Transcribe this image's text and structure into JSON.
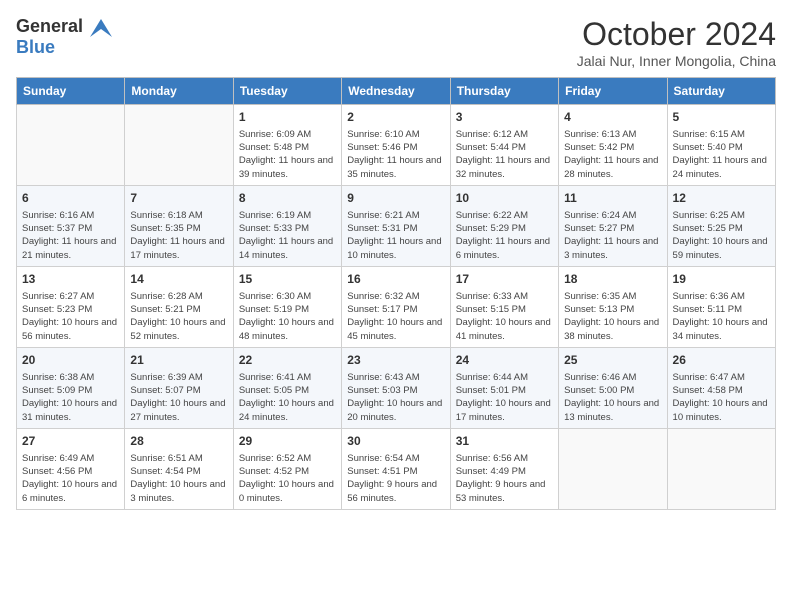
{
  "header": {
    "logo_general": "General",
    "logo_blue": "Blue",
    "month_title": "October 2024",
    "location": "Jalai Nur, Inner Mongolia, China"
  },
  "weekdays": [
    "Sunday",
    "Monday",
    "Tuesday",
    "Wednesday",
    "Thursday",
    "Friday",
    "Saturday"
  ],
  "weeks": [
    [
      {
        "day": "",
        "detail": ""
      },
      {
        "day": "",
        "detail": ""
      },
      {
        "day": "1",
        "detail": "Sunrise: 6:09 AM\nSunset: 5:48 PM\nDaylight: 11 hours and 39 minutes."
      },
      {
        "day": "2",
        "detail": "Sunrise: 6:10 AM\nSunset: 5:46 PM\nDaylight: 11 hours and 35 minutes."
      },
      {
        "day": "3",
        "detail": "Sunrise: 6:12 AM\nSunset: 5:44 PM\nDaylight: 11 hours and 32 minutes."
      },
      {
        "day": "4",
        "detail": "Sunrise: 6:13 AM\nSunset: 5:42 PM\nDaylight: 11 hours and 28 minutes."
      },
      {
        "day": "5",
        "detail": "Sunrise: 6:15 AM\nSunset: 5:40 PM\nDaylight: 11 hours and 24 minutes."
      }
    ],
    [
      {
        "day": "6",
        "detail": "Sunrise: 6:16 AM\nSunset: 5:37 PM\nDaylight: 11 hours and 21 minutes."
      },
      {
        "day": "7",
        "detail": "Sunrise: 6:18 AM\nSunset: 5:35 PM\nDaylight: 11 hours and 17 minutes."
      },
      {
        "day": "8",
        "detail": "Sunrise: 6:19 AM\nSunset: 5:33 PM\nDaylight: 11 hours and 14 minutes."
      },
      {
        "day": "9",
        "detail": "Sunrise: 6:21 AM\nSunset: 5:31 PM\nDaylight: 11 hours and 10 minutes."
      },
      {
        "day": "10",
        "detail": "Sunrise: 6:22 AM\nSunset: 5:29 PM\nDaylight: 11 hours and 6 minutes."
      },
      {
        "day": "11",
        "detail": "Sunrise: 6:24 AM\nSunset: 5:27 PM\nDaylight: 11 hours and 3 minutes."
      },
      {
        "day": "12",
        "detail": "Sunrise: 6:25 AM\nSunset: 5:25 PM\nDaylight: 10 hours and 59 minutes."
      }
    ],
    [
      {
        "day": "13",
        "detail": "Sunrise: 6:27 AM\nSunset: 5:23 PM\nDaylight: 10 hours and 56 minutes."
      },
      {
        "day": "14",
        "detail": "Sunrise: 6:28 AM\nSunset: 5:21 PM\nDaylight: 10 hours and 52 minutes."
      },
      {
        "day": "15",
        "detail": "Sunrise: 6:30 AM\nSunset: 5:19 PM\nDaylight: 10 hours and 48 minutes."
      },
      {
        "day": "16",
        "detail": "Sunrise: 6:32 AM\nSunset: 5:17 PM\nDaylight: 10 hours and 45 minutes."
      },
      {
        "day": "17",
        "detail": "Sunrise: 6:33 AM\nSunset: 5:15 PM\nDaylight: 10 hours and 41 minutes."
      },
      {
        "day": "18",
        "detail": "Sunrise: 6:35 AM\nSunset: 5:13 PM\nDaylight: 10 hours and 38 minutes."
      },
      {
        "day": "19",
        "detail": "Sunrise: 6:36 AM\nSunset: 5:11 PM\nDaylight: 10 hours and 34 minutes."
      }
    ],
    [
      {
        "day": "20",
        "detail": "Sunrise: 6:38 AM\nSunset: 5:09 PM\nDaylight: 10 hours and 31 minutes."
      },
      {
        "day": "21",
        "detail": "Sunrise: 6:39 AM\nSunset: 5:07 PM\nDaylight: 10 hours and 27 minutes."
      },
      {
        "day": "22",
        "detail": "Sunrise: 6:41 AM\nSunset: 5:05 PM\nDaylight: 10 hours and 24 minutes."
      },
      {
        "day": "23",
        "detail": "Sunrise: 6:43 AM\nSunset: 5:03 PM\nDaylight: 10 hours and 20 minutes."
      },
      {
        "day": "24",
        "detail": "Sunrise: 6:44 AM\nSunset: 5:01 PM\nDaylight: 10 hours and 17 minutes."
      },
      {
        "day": "25",
        "detail": "Sunrise: 6:46 AM\nSunset: 5:00 PM\nDaylight: 10 hours and 13 minutes."
      },
      {
        "day": "26",
        "detail": "Sunrise: 6:47 AM\nSunset: 4:58 PM\nDaylight: 10 hours and 10 minutes."
      }
    ],
    [
      {
        "day": "27",
        "detail": "Sunrise: 6:49 AM\nSunset: 4:56 PM\nDaylight: 10 hours and 6 minutes."
      },
      {
        "day": "28",
        "detail": "Sunrise: 6:51 AM\nSunset: 4:54 PM\nDaylight: 10 hours and 3 minutes."
      },
      {
        "day": "29",
        "detail": "Sunrise: 6:52 AM\nSunset: 4:52 PM\nDaylight: 10 hours and 0 minutes."
      },
      {
        "day": "30",
        "detail": "Sunrise: 6:54 AM\nSunset: 4:51 PM\nDaylight: 9 hours and 56 minutes."
      },
      {
        "day": "31",
        "detail": "Sunrise: 6:56 AM\nSunset: 4:49 PM\nDaylight: 9 hours and 53 minutes."
      },
      {
        "day": "",
        "detail": ""
      },
      {
        "day": "",
        "detail": ""
      }
    ]
  ]
}
